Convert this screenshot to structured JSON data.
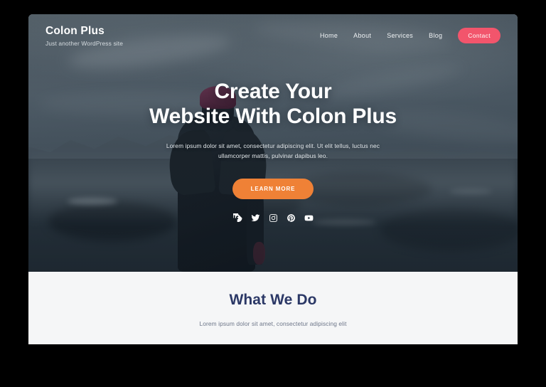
{
  "site": {
    "brand_title": "Colon Plus",
    "brand_tagline": "Just another WordPress site"
  },
  "nav": {
    "items": [
      {
        "label": "Home"
      },
      {
        "label": "About"
      },
      {
        "label": "Services"
      },
      {
        "label": "Blog"
      }
    ],
    "cta_label": "Contact",
    "cta_color": "#f2556c"
  },
  "hero": {
    "heading_line1": "Create Your",
    "heading_line2": "Website With Colon Plus",
    "paragraph": "Lorem ipsum dolor sit amet, consectetur adipiscing elit. Ut elit tellus, luctus nec ullamcorper mattis, pulvinar dapibus leo.",
    "button_label": "LEARN MORE",
    "button_color": "#ef8136",
    "socials": [
      {
        "name": "facebook-icon"
      },
      {
        "name": "twitter-icon"
      },
      {
        "name": "instagram-icon"
      },
      {
        "name": "pinterest-icon"
      },
      {
        "name": "youtube-icon"
      }
    ]
  },
  "what_we_do": {
    "title": "What We Do",
    "subtitle": "Lorem ipsum dolor sit amet, consectetur adipiscing elit",
    "title_color": "#2b3866"
  }
}
